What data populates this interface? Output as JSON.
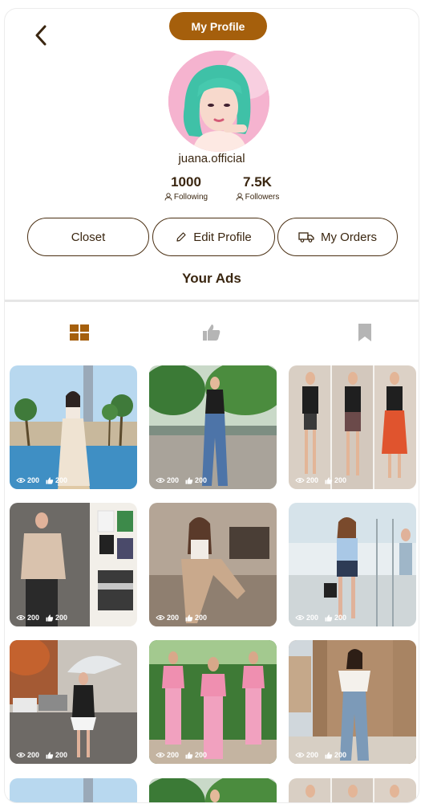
{
  "header": {
    "title": "My Profile"
  },
  "profile": {
    "username": "juana.official",
    "following_count": "1000",
    "following_label": "Following",
    "followers_count": "7.5K",
    "followers_label": "Followers"
  },
  "actions": {
    "closet": "Closet",
    "edit_profile": "Edit Profile",
    "my_orders": "My Orders"
  },
  "ads_section": {
    "title": "Your Ads"
  },
  "tabs": [
    "grid-icon",
    "thumbs-up-icon",
    "bookmark-icon"
  ],
  "colors": {
    "accent": "#a55f0c",
    "text": "#3a2610"
  },
  "ads": [
    {
      "views": "200",
      "likes": "200"
    },
    {
      "views": "200",
      "likes": "200"
    },
    {
      "views": "200",
      "likes": "200"
    },
    {
      "views": "200",
      "likes": "200"
    },
    {
      "views": "200",
      "likes": "200"
    },
    {
      "views": "200",
      "likes": "200"
    },
    {
      "views": "200",
      "likes": "200"
    },
    {
      "views": "200",
      "likes": "200"
    },
    {
      "views": "200",
      "likes": "200"
    }
  ]
}
